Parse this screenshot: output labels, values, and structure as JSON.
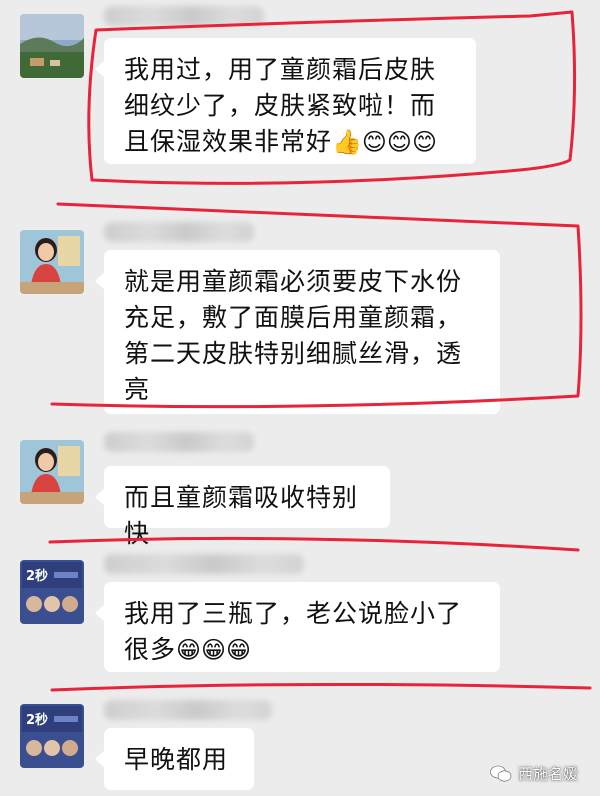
{
  "messages": [
    {
      "text": "我用过，用了童颜霜后皮肤细纹少了，皮肤紧致啦！而且保湿效果非常好",
      "emojis": "👍😊😊😊"
    },
    {
      "text": "就是用童颜霜必须要皮下水份充足，敷了面膜后用童颜霜，第二天皮肤特别细腻丝滑，透亮",
      "emojis": ""
    },
    {
      "text": "而且童颜霜吸收特别快",
      "emojis": ""
    },
    {
      "text": "我用了三瓶了，老公说脸小了很多",
      "emojis": "😁😁😁"
    },
    {
      "text": "早晚都用",
      "emojis": ""
    }
  ],
  "avatars": {
    "product_text": "2秒"
  },
  "watermark": {
    "label": "西施名媛"
  },
  "colors": {
    "highlight_marker": "#e8233a",
    "bubble": "#ffffff",
    "background": "#ececec"
  }
}
